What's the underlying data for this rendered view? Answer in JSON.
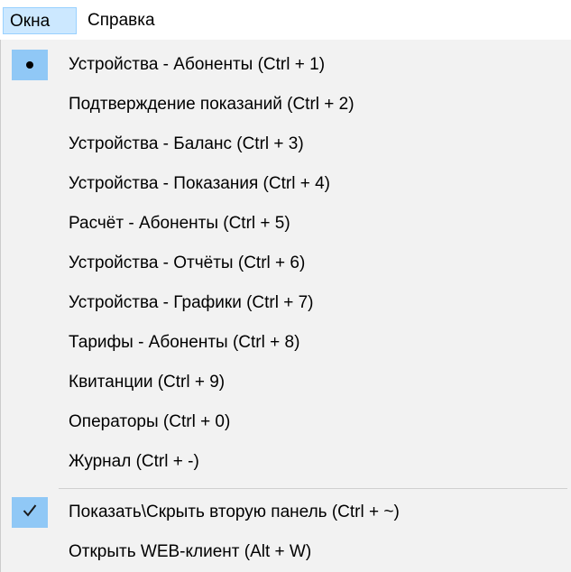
{
  "menubar": {
    "items": [
      {
        "label": "Окна",
        "active": true
      },
      {
        "label": "Справка",
        "active": false
      }
    ]
  },
  "dropdown": {
    "items": [
      {
        "label": "Устройства - Абоненты (Ctrl + 1)",
        "mark": "radio"
      },
      {
        "label": "Подтверждение показаний (Ctrl + 2)",
        "mark": ""
      },
      {
        "label": "Устройства - Баланс (Ctrl + 3)",
        "mark": ""
      },
      {
        "label": "Устройства - Показания (Ctrl + 4)",
        "mark": ""
      },
      {
        "label": "Расчёт - Абоненты (Ctrl + 5)",
        "mark": ""
      },
      {
        "label": "Устройства - Отчёты (Ctrl + 6)",
        "mark": ""
      },
      {
        "label": "Устройства - Графики (Ctrl + 7)",
        "mark": ""
      },
      {
        "label": "Тарифы - Абоненты (Ctrl + 8)",
        "mark": ""
      },
      {
        "label": "Квитанции (Ctrl + 9)",
        "mark": ""
      },
      {
        "label": "Операторы (Ctrl + 0)",
        "mark": ""
      },
      {
        "label": "Журнал (Ctrl + -)",
        "mark": ""
      }
    ],
    "extra_items": [
      {
        "label": "Показать\\Скрыть вторую панель (Ctrl + ~)",
        "mark": "check"
      },
      {
        "label": "Открыть WEB-клиент (Alt + W)",
        "mark": ""
      }
    ]
  },
  "colors": {
    "menubar_active_bg": "#cce8ff",
    "mark_bg": "#90c8f6",
    "dropdown_bg": "#f2f2f2"
  }
}
